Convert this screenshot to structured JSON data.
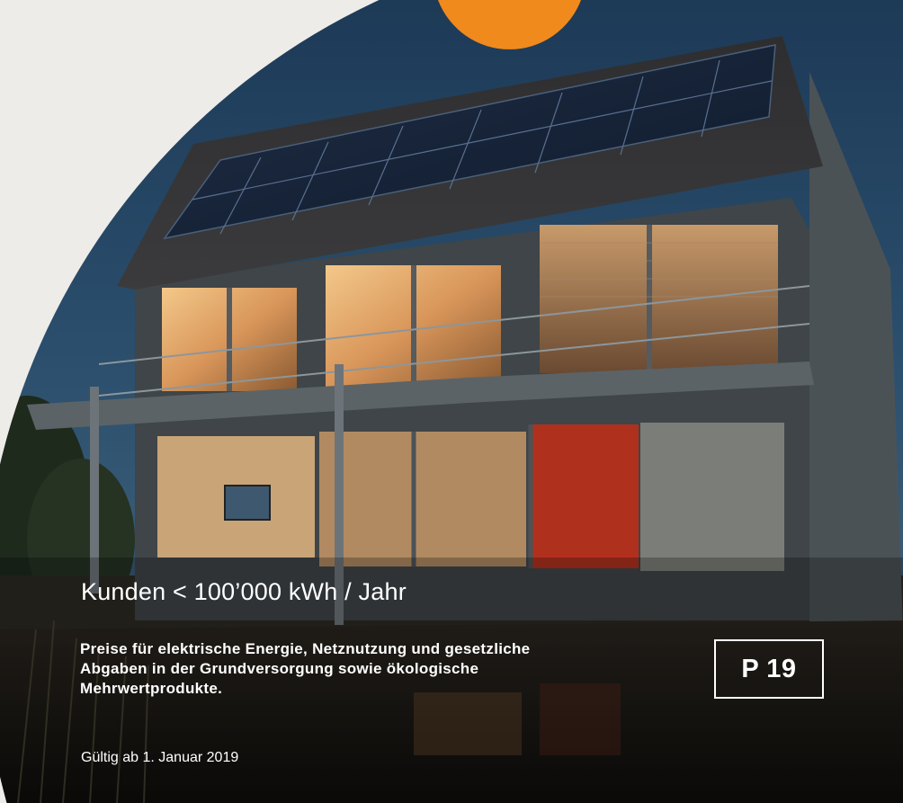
{
  "cover": {
    "title": "Kunden < 100’000 kWh / Jahr",
    "description_lines": [
      "Preise für elektrische Energie, Netznutzung und gesetzliche",
      "Abgaben in der Grundversorgung sowie ökologische",
      "Mehrwertprodukte."
    ],
    "badge": "P 19",
    "valid_from": "Gültig ab 1. Januar 2019"
  },
  "colors": {
    "background": "#eeece8",
    "accent_orange": "#f08a1c",
    "text": "#ffffff"
  },
  "image": {
    "subject": "house-with-solar-panels-at-dusk-photo"
  }
}
